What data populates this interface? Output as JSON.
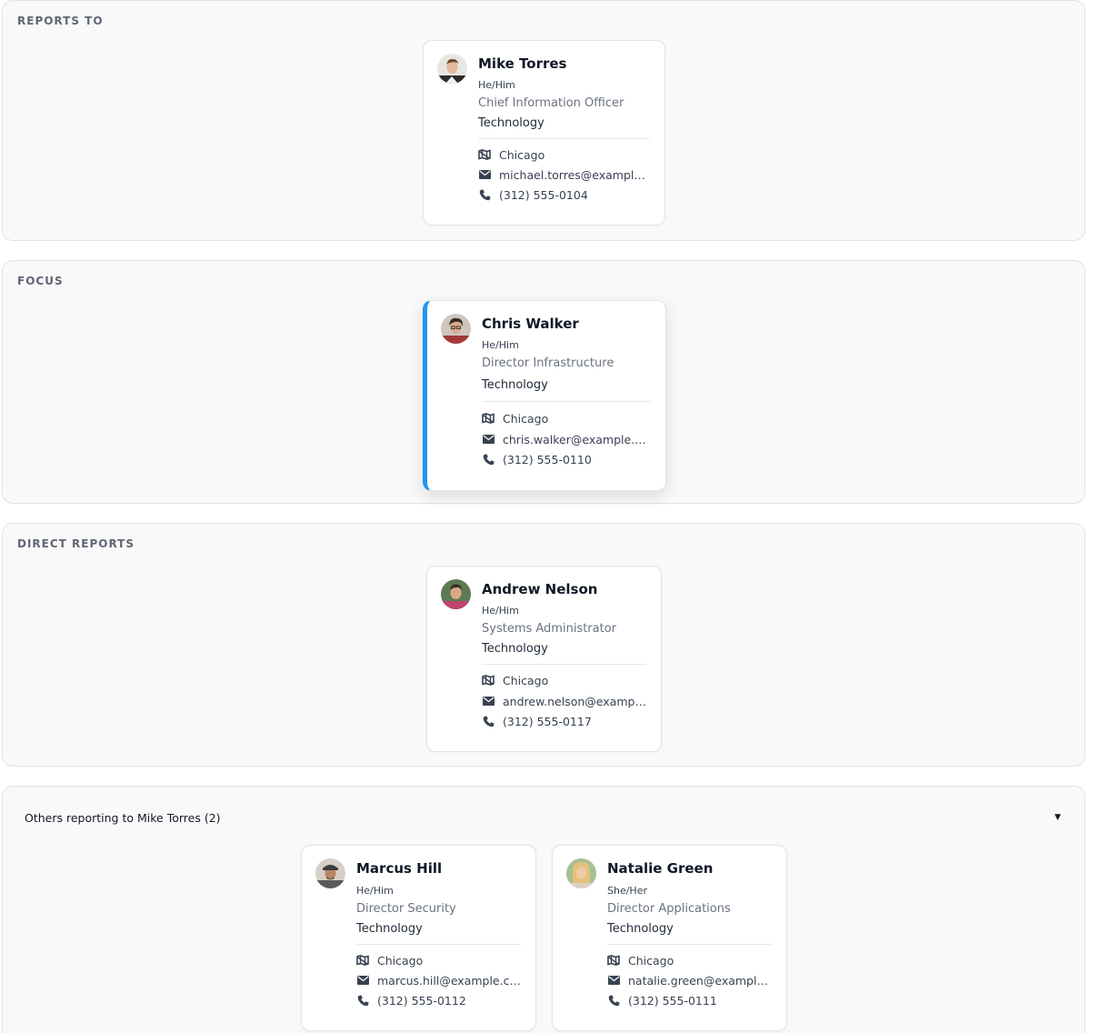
{
  "sections": {
    "reports_to": {
      "title": "REPORTS TO"
    },
    "focus": {
      "title": "FOCUS"
    },
    "direct_reports": {
      "title": "DIRECT REPORTS"
    },
    "others": {
      "title": "Others reporting to Mike Torres (2)",
      "toggle_icon": "▼"
    }
  },
  "people": {
    "manager": {
      "name": "Mike Torres",
      "pronouns": "He/Him",
      "title": "Chief Information Officer",
      "department": "Technology",
      "location": "Chicago",
      "email": "michael.torres@example.com",
      "phone": "(312) 555-0104"
    },
    "focus": {
      "name": "Chris Walker",
      "pronouns": "He/Him",
      "title": "Director Infrastructure",
      "department": "Technology",
      "location": "Chicago",
      "email": "chris.walker@example.com",
      "phone": "(312) 555-0110"
    },
    "direct": {
      "name": "Andrew Nelson",
      "pronouns": "He/Him",
      "title": "Systems Administrator",
      "department": "Technology",
      "location": "Chicago",
      "email": "andrew.nelson@example....",
      "phone": "(312) 555-0117"
    },
    "peer1": {
      "name": "Marcus Hill",
      "pronouns": "He/Him",
      "title": "Director Security",
      "department": "Technology",
      "location": "Chicago",
      "email": "marcus.hill@example.com",
      "phone": "(312) 555-0112"
    },
    "peer2": {
      "name": "Natalie Green",
      "pronouns": "She/Her",
      "title": "Director Applications",
      "department": "Technology",
      "location": "Chicago",
      "email": "natalie.green@example.co...",
      "phone": "(312) 555-0111"
    }
  },
  "icons": {
    "location": "map-icon",
    "email": "envelope-icon",
    "phone": "phone-icon"
  },
  "colors": {
    "focus_accent": "#2196f3"
  }
}
